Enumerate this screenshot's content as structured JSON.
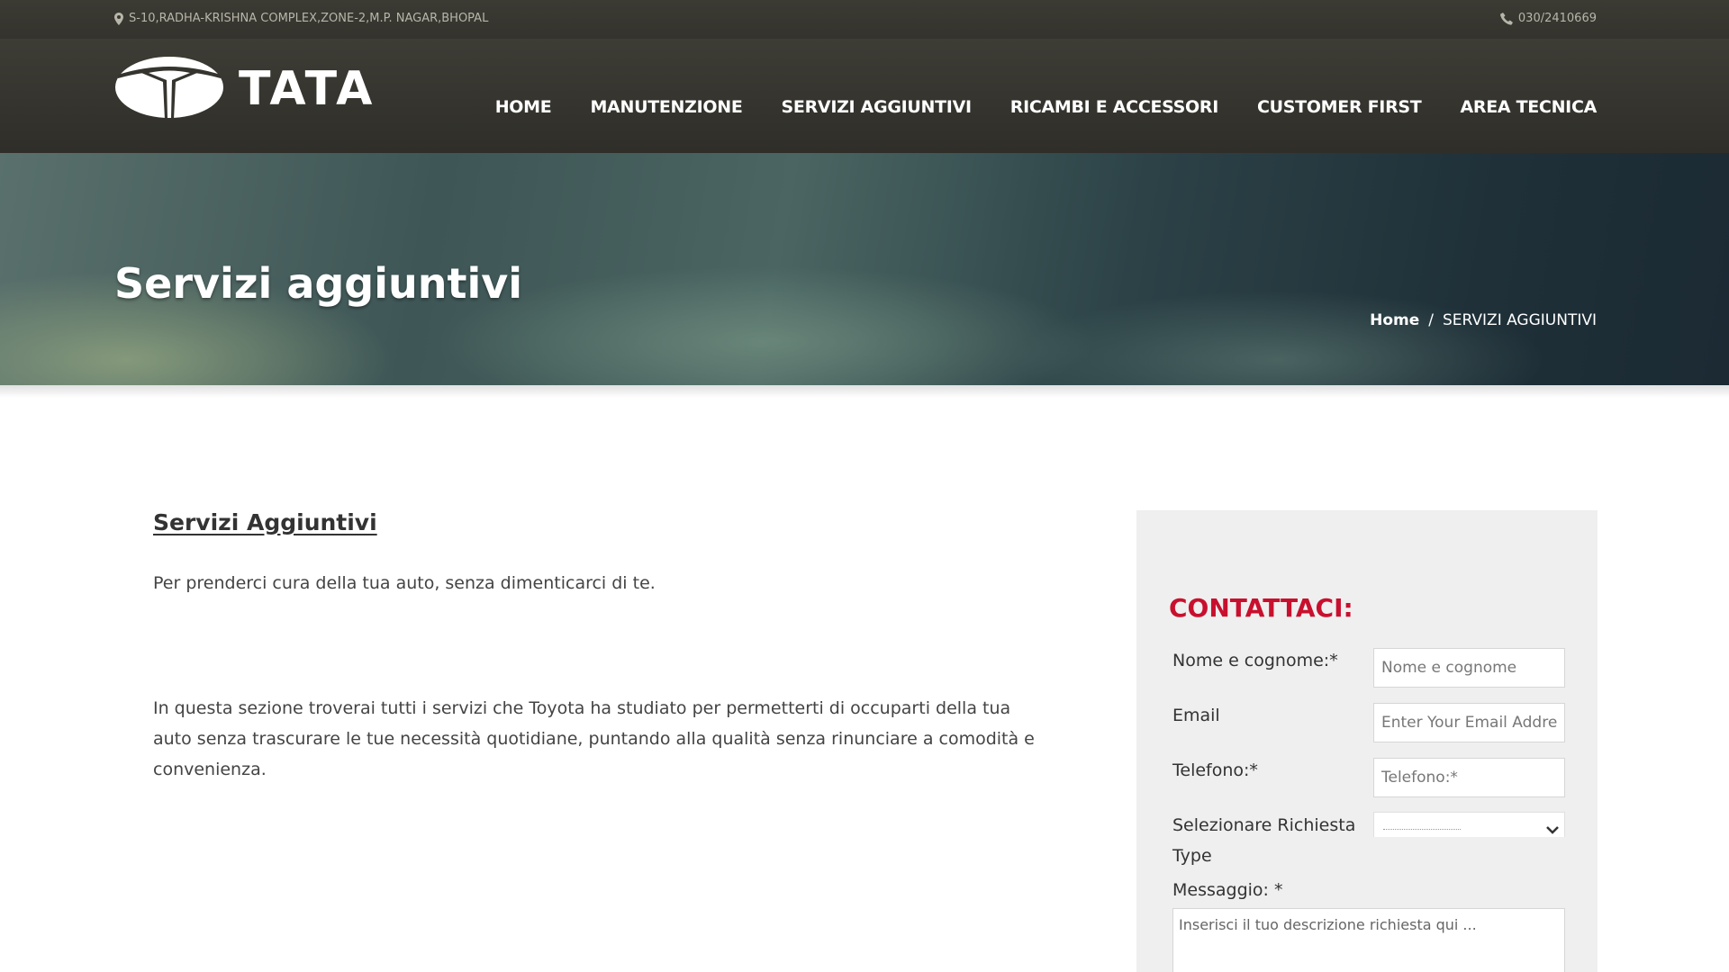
{
  "topbar": {
    "address": "S-10,RADHA-KRISHNA COMPLEX,ZONE-2,M.P. NAGAR,BHOPAL",
    "phone": "030/2410669"
  },
  "brand": {
    "name": "TATA"
  },
  "nav": {
    "items": [
      {
        "label": "HOME"
      },
      {
        "label": "MANUTENZIONE"
      },
      {
        "label": "SERVIZI AGGIUNTIVI"
      },
      {
        "label": "RICAMBI E ACCESSORI"
      },
      {
        "label": "CUSTOMER FIRST"
      },
      {
        "label": "AREA TECNICA"
      }
    ]
  },
  "hero": {
    "title": "Servizi aggiuntivi",
    "breadcrumb": {
      "home": "Home",
      "separator": "/",
      "current": "SERVIZI AGGIUNTIVI"
    }
  },
  "content": {
    "heading": "Servizi Aggiuntivi",
    "intro": "Per prenderci cura della tua auto, senza dimenticarci di te.",
    "body": "In questa sezione troverai tutti i servizi che Toyota ha studiato per permetterti di occuparti della tua auto senza trascurare le tue necessità quotidiane, puntando alla qualità senza rinunciare a comodità e convenienza."
  },
  "contact": {
    "title": "CONTATTACI:",
    "name_label": "Nome e cognome:*",
    "name_placeholder": "Nome e cognome",
    "email_label": "Email",
    "email_placeholder": "Enter Your Email Address",
    "phone_label": "Telefono:*",
    "phone_placeholder": "Telefono:*",
    "request_label": "Selezionare Richiesta Type",
    "message_label": "Messaggio: *",
    "message_placeholder": "Inserisci il tuo descrizione richiesta qui ..."
  },
  "colors": {
    "accent_red": "#c8102e",
    "header_bg": "#35342e"
  }
}
